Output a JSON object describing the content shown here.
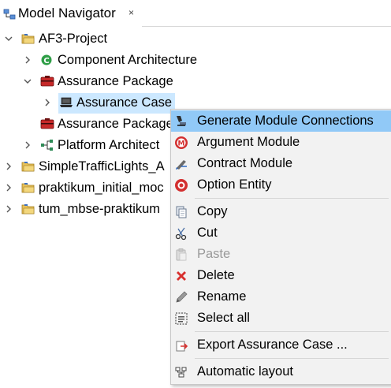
{
  "view": {
    "title": "Model Navigator",
    "close_glyph": "×"
  },
  "tree": {
    "root": {
      "label": "AF3-Project",
      "icon": "folder-project-icon",
      "expanded": true
    },
    "component_architecture": {
      "label": "Component Architecture",
      "icon": "component-icon"
    },
    "assurance_package_1": {
      "label": "Assurance Package",
      "icon": "assurance-package-icon",
      "expanded": true
    },
    "assurance_case": {
      "label": "Assurance Case",
      "icon": "assurance-case-icon",
      "selected": true
    },
    "assurance_package_2": {
      "label": "Assurance Package",
      "icon": "assurance-package-icon"
    },
    "platform_architecture": {
      "label": "Platform Architect",
      "icon": "platform-icon"
    },
    "project_2": {
      "label": "SimpleTrafficLights_A",
      "icon": "folder-project-icon"
    },
    "project_3": {
      "label": "praktikum_initial_moc",
      "icon": "folder-project-icon"
    },
    "project_4": {
      "label": "tum_mbse-praktikum",
      "icon": "folder-project-icon"
    }
  },
  "context_menu": {
    "items": [
      {
        "label": "Generate Module Connections",
        "icon": "module-connections-icon",
        "highlighted": true,
        "enabled": true
      },
      {
        "label": "Argument Module",
        "icon": "argument-module-icon",
        "enabled": true
      },
      {
        "label": "Contract Module",
        "icon": "contract-module-icon",
        "enabled": true
      },
      {
        "label": "Option Entity",
        "icon": "option-entity-icon",
        "enabled": true
      },
      {
        "label": "Copy",
        "icon": "copy-icon",
        "enabled": true
      },
      {
        "label": "Cut",
        "icon": "cut-icon",
        "enabled": true
      },
      {
        "label": "Paste",
        "icon": "paste-icon",
        "enabled": false
      },
      {
        "label": "Delete",
        "icon": "delete-icon",
        "enabled": true
      },
      {
        "label": "Rename",
        "icon": "rename-icon",
        "enabled": true
      },
      {
        "label": "Select all",
        "icon": "select-all-icon",
        "enabled": true
      },
      {
        "label": "Export Assurance Case ...",
        "icon": "export-icon",
        "enabled": true
      },
      {
        "label": "Automatic layout",
        "icon": "automatic-layout-icon",
        "enabled": true
      }
    ]
  },
  "colors": {
    "selection": "#cce8ff",
    "menu_highlight": "#91c9f7",
    "menu_background": "#f2f2f2",
    "disabled_text": "#9a9a9a"
  }
}
